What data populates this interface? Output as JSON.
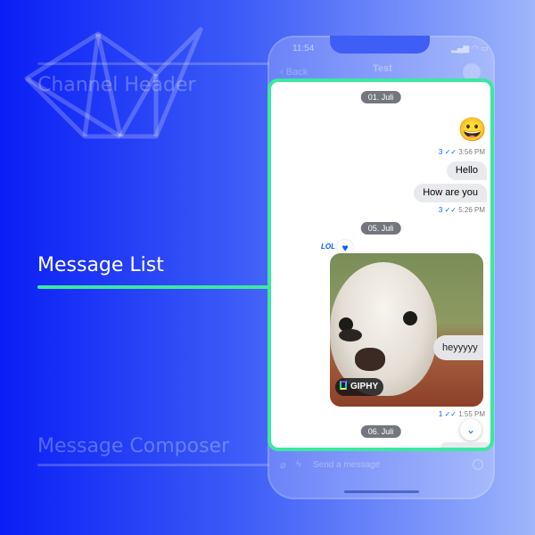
{
  "section_labels": {
    "channel_header": "Channel Header",
    "message_list": "Message List",
    "message_composer": "Message Composer"
  },
  "status_bar": {
    "time": "11:54",
    "icons": "▂▄▆ ◠ ▭"
  },
  "header": {
    "back_label": "Back",
    "title": "Test"
  },
  "messages": {
    "date1": "01. Juli",
    "emoji": "😀",
    "meta1": {
      "count": "3",
      "check": "✓✓",
      "time": "3:56 PM"
    },
    "bubble_hello": "Hello",
    "bubble_how": "How are you",
    "meta2": {
      "count": "3",
      "check": "✓✓",
      "time": "5:26 PM"
    },
    "date2": "05. Juli",
    "reaction_lol": "LOL",
    "reaction_heart": "♥",
    "gif_text": "heyyyyy",
    "giphy_badge": "GIPHY",
    "meta3": {
      "count": "1",
      "check": "✓✓",
      "time": "1:55 PM"
    },
    "date3": "06. Juli",
    "scroll_down": "⌄"
  },
  "composer": {
    "clip": "⌀",
    "bolt": "ϟ",
    "placeholder": "Send a message"
  },
  "colors": {
    "accent_green": "#3ce8a0",
    "brand_blue": "#005fff"
  }
}
